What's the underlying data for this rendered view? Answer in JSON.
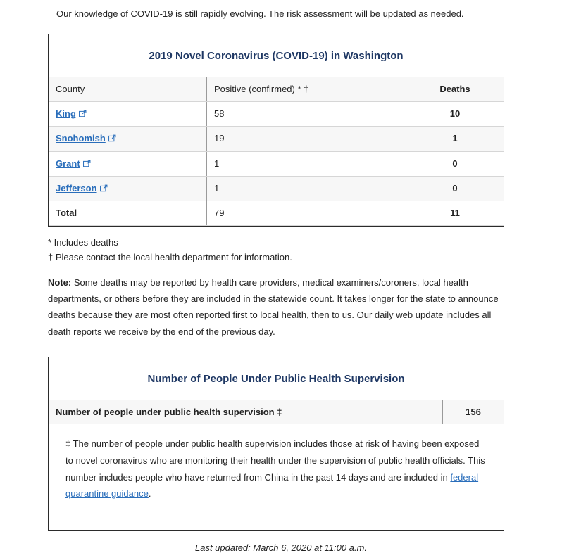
{
  "intro": "Our knowledge of COVID-19 is still rapidly evolving. The risk assessment will be updated as needed.",
  "colors": {
    "heading": "#1f3864",
    "link": "#2a6ebb",
    "border": "#2b2b2b",
    "row_stripe": "#f7f7f7"
  },
  "covid_table": {
    "title": "2019 Novel Coronavirus (COVID-19) in Washington",
    "columns": [
      "County",
      "Positive (confirmed) * †",
      "Deaths"
    ],
    "rows": [
      {
        "county": "King",
        "has_link": true,
        "icon": "external-link-icon",
        "positive": "58",
        "deaths": "10"
      },
      {
        "county": "Snohomish",
        "has_link": true,
        "icon": "external-link-icon",
        "positive": "19",
        "deaths": "1"
      },
      {
        "county": "Grant",
        "has_link": true,
        "icon": "external-link-icon",
        "positive": "1",
        "deaths": "0"
      },
      {
        "county": "Jefferson",
        "has_link": true,
        "icon": "external-link-icon",
        "positive": "1",
        "deaths": "0"
      }
    ],
    "total": {
      "label": "Total",
      "positive": "79",
      "deaths": "11"
    }
  },
  "footnotes": {
    "asterisk": "* Includes deaths",
    "dagger": "† Please contact the local health department for information.",
    "note_label": "Note:",
    "note_body": " Some deaths may be reported by health care providers, medical examiners/coroners, local health departments, or others before they are included in the statewide count. It takes longer for the state to announce deaths because they are most often reported first to local health, then to us. Our daily web update includes all death reports we receive by the end of the previous day."
  },
  "supervision_table": {
    "title": "Number of People Under Public Health Supervision",
    "row_label": "Number of people under public health supervision ‡",
    "row_value": "156",
    "note_symbol": "‡",
    "note_part1": " The number of people under public health supervision includes those at risk of having been exposed to novel coronavirus who are monitoring their health under the supervision of public health officials. This number includes people who have returned from China in the past 14 days and are included in ",
    "note_link": "federal quarantine guidance",
    "note_part2": "."
  },
  "footer": {
    "last_updated": "Last updated: March 6, 2020 at 11:00 a.m."
  }
}
